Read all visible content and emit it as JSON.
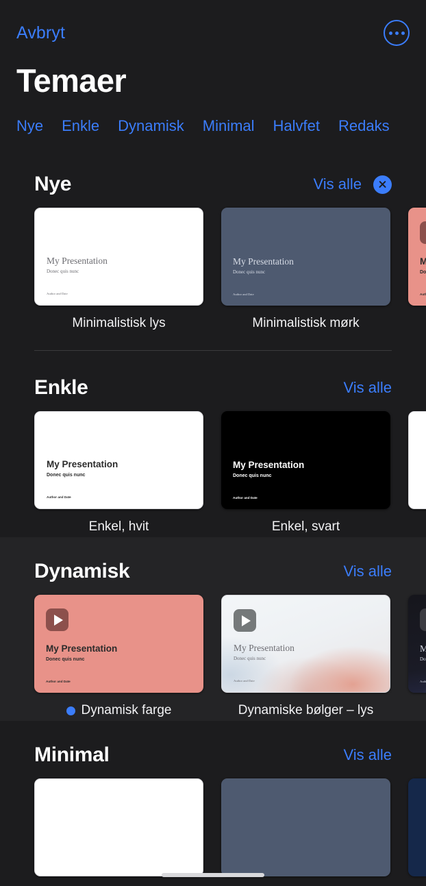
{
  "nav": {
    "cancel_label": "Avbryt",
    "more_icon": "ellipsis-circle-icon"
  },
  "page_title": "Temaer",
  "tabs": [
    {
      "label": "Nye"
    },
    {
      "label": "Enkle"
    },
    {
      "label": "Dynamisk"
    },
    {
      "label": "Minimal"
    },
    {
      "label": "Halvfet"
    },
    {
      "label": "Redaks"
    }
  ],
  "common": {
    "show_all_label": "Vis alle",
    "slide_title": "My Presentation",
    "slide_subtitle": "Donec quis nunc",
    "slide_author": "Author and Date"
  },
  "accent_color": "#3b7dfb",
  "sections": [
    {
      "title": "Nye",
      "show_all": "Vis alle",
      "has_close": true,
      "close_icon": "close-circle-icon",
      "cards": [
        {
          "label": "Minimalistisk lys",
          "selected": false
        },
        {
          "label": "Minimalistisk mørk",
          "selected": false
        },
        {
          "label": "",
          "selected": false
        }
      ]
    },
    {
      "title": "Enkle",
      "show_all": "Vis alle",
      "has_close": false,
      "cards": [
        {
          "label": "Enkel, hvit",
          "selected": false
        },
        {
          "label": "Enkel, svart",
          "selected": false
        },
        {
          "label": "",
          "selected": false
        }
      ]
    },
    {
      "title": "Dynamisk",
      "show_all": "Vis alle",
      "has_close": false,
      "cards": [
        {
          "label": "Dynamisk farge",
          "selected": true
        },
        {
          "label": "Dynamiske bølger – lys",
          "selected": false
        },
        {
          "label": "",
          "selected": false
        }
      ]
    },
    {
      "title": "Minimal",
      "show_all": "Vis alle",
      "has_close": false,
      "cards": [
        {
          "label": "",
          "selected": false
        },
        {
          "label": "",
          "selected": false
        },
        {
          "label": "",
          "selected": false
        }
      ]
    }
  ]
}
